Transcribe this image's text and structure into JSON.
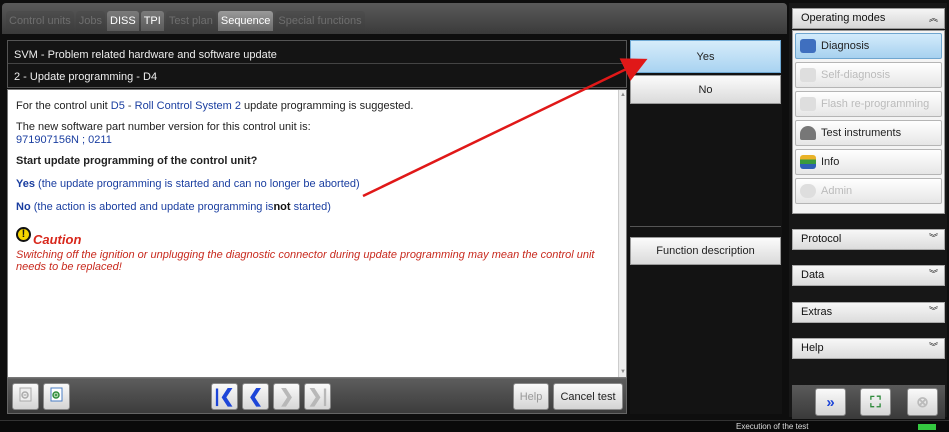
{
  "tabs": [
    {
      "label": "Control units",
      "state": "disabled"
    },
    {
      "label": "Jobs",
      "state": "disabled"
    },
    {
      "label": "DISS",
      "state": "enabled"
    },
    {
      "label": "TPI",
      "state": "enabled"
    },
    {
      "label": "Test plan",
      "state": "disabled"
    },
    {
      "label": "Sequence",
      "state": "selected"
    },
    {
      "label": "Special functions",
      "state": "disabled"
    }
  ],
  "header": {
    "line1": "SVM - Problem related hardware and software update",
    "line2": "2 - Update programming - D4"
  },
  "content": {
    "p1_prefix": "For the control unit ",
    "p1_unit": "D5",
    "p1_sep": " - ",
    "p1_name": "Roll Control System 2",
    "p1_suffix": " update programming is suggested.",
    "p2_text": "The new software part number version for this control unit is:",
    "p2_value": "971907156N ; 0211",
    "question": "Start update programming of the control unit?",
    "yes_word": "Yes",
    "yes_rest": " (the update programming is started and can no longer be aborted)",
    "no_word": "No",
    "no_rest": " (the action is aborted and update programming is",
    "no_bold": "not",
    "no_end": " started)",
    "caution_title": "Caution",
    "caution_text": "Switching off the ignition or unplugging the diagnostic connector during update programming may mean the control unit needs to be replaced!"
  },
  "toolbar": {
    "help_label": "Help",
    "cancel_label": "Cancel test"
  },
  "actions": {
    "yes_label": "Yes",
    "no_label": "No",
    "function_description_label": "Function description"
  },
  "right_panel": {
    "operating_modes_label": "Operating modes",
    "modes": [
      {
        "label": "Diagnosis",
        "state": "active",
        "icon": "stethoscope-icon"
      },
      {
        "label": "Self-diagnosis",
        "state": "disabled",
        "icon": "self-diagnosis-icon"
      },
      {
        "label": "Flash re-programming",
        "state": "disabled",
        "icon": "flash-icon"
      },
      {
        "label": "Test instruments",
        "state": "enabled",
        "icon": "gauge-icon"
      },
      {
        "label": "Info",
        "state": "enabled",
        "icon": "info-books-icon"
      },
      {
        "label": "Admin",
        "state": "disabled",
        "icon": "admin-icon"
      }
    ],
    "sections": [
      "Protocol",
      "Data",
      "Extras",
      "Help"
    ]
  },
  "status": {
    "text": "Execution of the test"
  },
  "colors": {
    "accent_blue": "#1d45d8",
    "caution_red": "#d8281c",
    "arrow_red": "#e01818",
    "active_button": "#a9d3f1"
  }
}
